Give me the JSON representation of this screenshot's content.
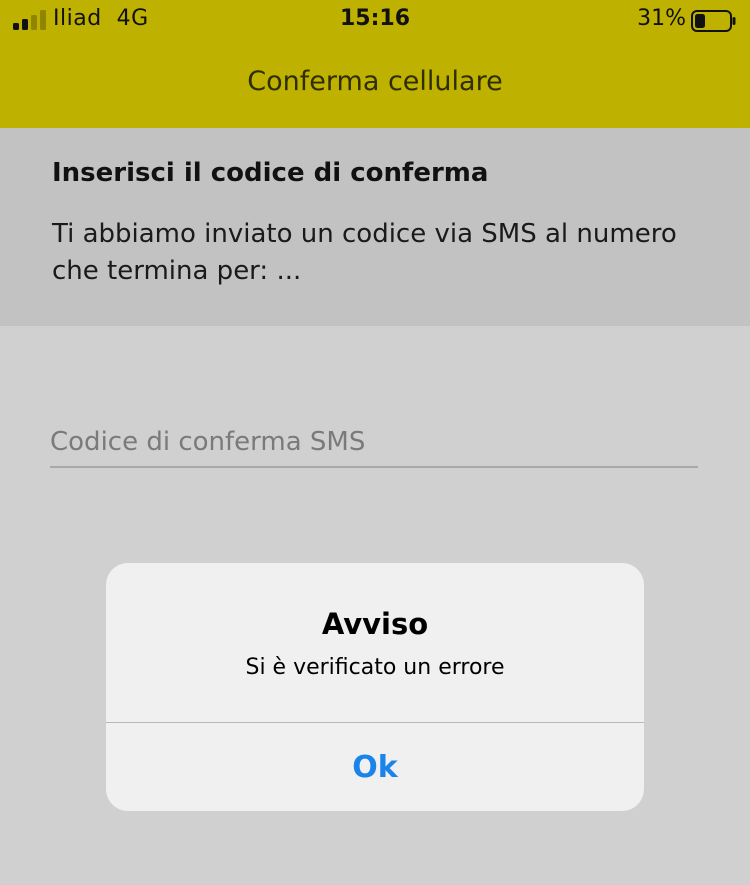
{
  "status_bar": {
    "carrier": "Iliad",
    "network": "4G",
    "time": "15:16",
    "battery_percent": "31%",
    "signal_bars_filled": 2,
    "signal_bars_total": 4,
    "battery_level": 0.31
  },
  "nav": {
    "title": "Conferma cellulare"
  },
  "info": {
    "heading": "Inserisci il codice di conferma",
    "body": "Ti abbiamo inviato un codice via SMS al numero che termina per: ..."
  },
  "form": {
    "sms_code_value": "",
    "sms_code_placeholder": "Codice di conferma SMS"
  },
  "alert": {
    "title": "Avviso",
    "message": "Si è verificato un errore",
    "ok_label": "Ok"
  },
  "colors": {
    "header_bg": "#bfb100",
    "accent_blue": "#1a84ea",
    "overlay_bg": "#d0d0d0"
  },
  "icons": {
    "signal": "cellular-signal-icon",
    "battery": "battery-icon"
  }
}
